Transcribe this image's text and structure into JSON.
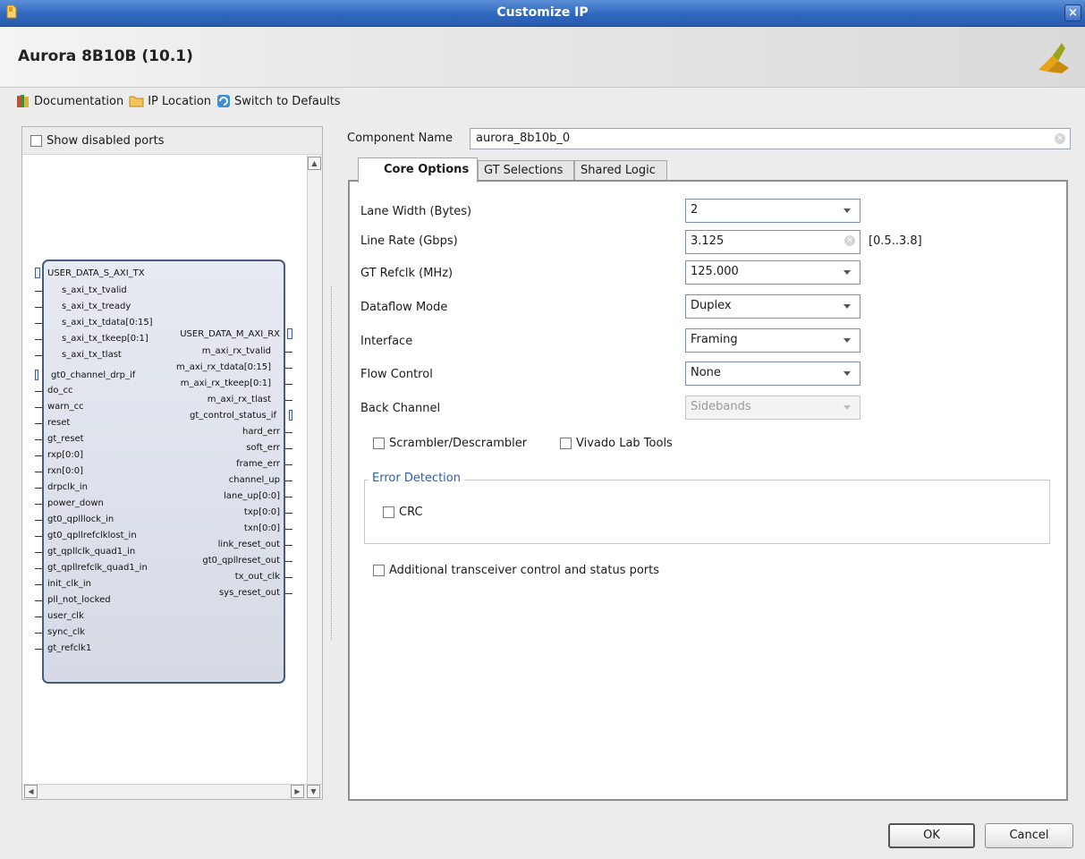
{
  "window": {
    "title": "Customize IP",
    "close_glyph": "×"
  },
  "header": {
    "ip_name": "Aurora 8B10B (10.1)"
  },
  "toolbar": {
    "documentation": "Documentation",
    "ip_location": "IP Location",
    "switch_defaults": "Switch to Defaults"
  },
  "left": {
    "show_disabled_label": "Show disabled ports",
    "block": {
      "left_bus": "USER_DATA_S_AXI_TX",
      "left_bus_pins": [
        "s_axi_tx_tvalid",
        "s_axi_tx_tready",
        "s_axi_tx_tdata[0:15]",
        "s_axi_tx_tkeep[0:1]",
        "s_axi_tx_tlast"
      ],
      "drp_bus": "gt0_channel_drp_if",
      "left_pins": [
        "do_cc",
        "warn_cc",
        "reset",
        "gt_reset",
        "rxp[0:0]",
        "rxn[0:0]",
        "drpclk_in",
        "power_down",
        "gt0_qplllock_in",
        "gt0_qpllrefclklost_in",
        "gt_qpllclk_quad1_in",
        "gt_qpllrefclk_quad1_in",
        "init_clk_in",
        "pll_not_locked",
        "user_clk",
        "sync_clk",
        "gt_refclk1"
      ],
      "right_bus": "USER_DATA_M_AXI_RX",
      "right_bus_pins": [
        "m_axi_rx_tvalid",
        "m_axi_rx_tdata[0:15]",
        "m_axi_rx_tkeep[0:1]",
        "m_axi_rx_tlast"
      ],
      "status_bus": "gt_control_status_if",
      "right_pins": [
        "hard_err",
        "soft_err",
        "frame_err",
        "channel_up",
        "lane_up[0:0]",
        "txp[0:0]",
        "txn[0:0]",
        "link_reset_out",
        "gt0_qpllreset_out",
        "tx_out_clk",
        "sys_reset_out"
      ]
    }
  },
  "form": {
    "component_name_label": "Component Name",
    "component_name_value": "aurora_8b10b_0",
    "tabs": [
      "Core Options",
      "GT Selections",
      "Shared Logic"
    ],
    "fields": {
      "lane_width": {
        "label": "Lane Width (Bytes)",
        "value": "2"
      },
      "line_rate": {
        "label": "Line Rate (Gbps)",
        "value": "3.125",
        "range": "[0.5..3.8]"
      },
      "gt_refclk": {
        "label": "GT Refclk (MHz)",
        "value": "125.000"
      },
      "dataflow": {
        "label": "Dataflow Mode",
        "value": "Duplex"
      },
      "interface": {
        "label": "Interface",
        "value": "Framing"
      },
      "flow_control": {
        "label": "Flow Control",
        "value": "None"
      },
      "back_channel": {
        "label": "Back Channel",
        "value": "Sidebands"
      }
    },
    "scrambler_label": "Scrambler/Descrambler",
    "vivado_lab_label": "Vivado Lab Tools",
    "error_detection_title": "Error Detection",
    "crc_label": "CRC",
    "additional_label": "Additional transceiver control and status ports"
  },
  "buttons": {
    "ok": "OK",
    "cancel": "Cancel"
  }
}
